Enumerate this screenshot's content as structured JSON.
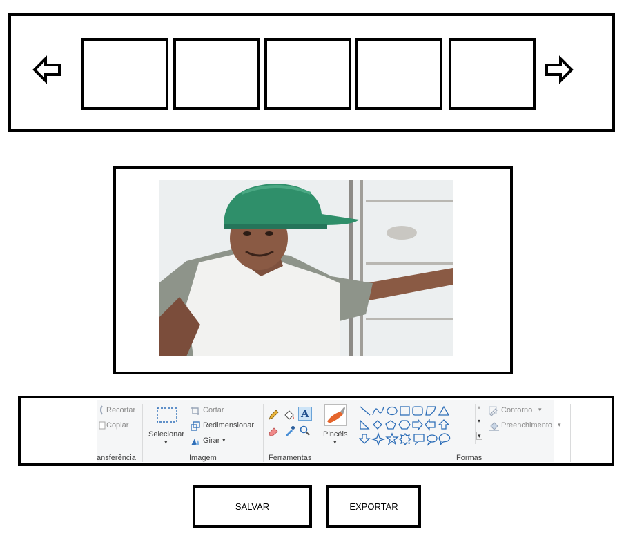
{
  "ribbon": {
    "clipboard": {
      "recortar": "Recortar",
      "copiar": "Copiar",
      "group_label": "ansferência"
    },
    "image": {
      "selecionar": "Selecionar",
      "cortar": "Cortar",
      "redimensionar": "Redimensionar",
      "girar": "Girar",
      "group_label": "Imagem"
    },
    "tools": {
      "group_label": "Ferramentas"
    },
    "brushes": {
      "label": "Pincéis"
    },
    "shapes": {
      "contorno": "Contorno",
      "preenchimento": "Preenchimento",
      "group_label": "Formas"
    }
  },
  "actions": {
    "save_label": "SALVAR",
    "export_label": "EXPORTAR"
  },
  "colors": {
    "helmet": "#2f8f6a",
    "shirt": "#8e948a",
    "skin": "#8a5a44",
    "ribbon_bg": "#f5f6f7",
    "accent_blue": "#2f6fb8"
  }
}
